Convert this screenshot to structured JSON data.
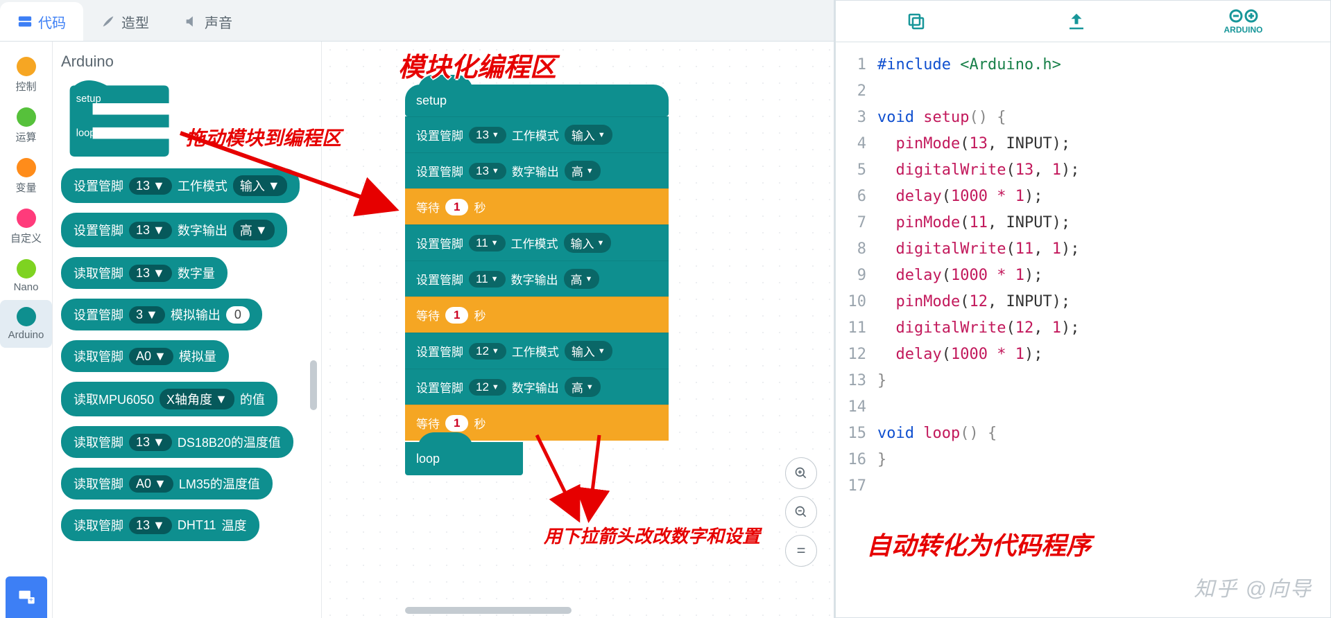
{
  "tabs": {
    "code": "代码",
    "costume": "造型",
    "sound": "声音"
  },
  "categories": [
    {
      "label": "控制",
      "color": "#f6a623"
    },
    {
      "label": "运算",
      "color": "#56c13b"
    },
    {
      "label": "变量",
      "color": "#ff8c1a"
    },
    {
      "label": "自定义",
      "color": "#ff3b7b"
    },
    {
      "label": "Nano",
      "color": "#7ed321"
    },
    {
      "label": "Arduino",
      "color": "#0e8f8f",
      "selected": true
    }
  ],
  "palette": {
    "title": "Arduino",
    "hat": {
      "setup": "setup",
      "loop": "loop"
    },
    "blocks": [
      {
        "parts": [
          "设置管脚",
          {
            "pill": "13 ▾"
          },
          "工作模式",
          {
            "pill": "输入 ▾"
          }
        ]
      },
      {
        "parts": [
          "设置管脚",
          {
            "pill": "13 ▾"
          },
          "数字输出",
          {
            "pill": "高 ▾"
          }
        ]
      },
      {
        "parts": [
          "读取管脚",
          {
            "pill": "13 ▾"
          },
          "数字量"
        ]
      },
      {
        "parts": [
          "设置管脚",
          {
            "pill": "3 ▾"
          },
          "模拟输出",
          {
            "oval": "0"
          }
        ]
      },
      {
        "parts": [
          "读取管脚",
          {
            "pill": "A0 ▾"
          },
          "模拟量"
        ]
      },
      {
        "parts": [
          "读取MPU6050",
          {
            "pill": "X轴角度 ▾"
          },
          "的值"
        ]
      },
      {
        "parts": [
          "读取管脚",
          {
            "pill": "13 ▾"
          },
          "DS18B20的温度值"
        ]
      },
      {
        "parts": [
          "读取管脚",
          {
            "pill": "A0 ▾"
          },
          "LM35的温度值"
        ]
      },
      {
        "parts": [
          "读取管脚",
          {
            "pill": "13"
          },
          "DHT11",
          "温度"
        ]
      }
    ]
  },
  "workspace": {
    "setup": "setup",
    "loop": "loop",
    "rows": [
      {
        "t": "teal",
        "parts": [
          "设置管脚",
          {
            "pill": "13 ▾"
          },
          "工作模式",
          {
            "pill": "输入 ▾"
          }
        ]
      },
      {
        "t": "teal",
        "parts": [
          "设置管脚",
          {
            "pill": "13 ▾"
          },
          "数字输出",
          {
            "pill": "高 ▾"
          }
        ]
      },
      {
        "t": "orange",
        "parts": [
          "等待",
          {
            "oval": "1"
          },
          "秒"
        ]
      },
      {
        "t": "teal",
        "parts": [
          "设置管脚",
          {
            "pill": "11 ▾"
          },
          "工作模式",
          {
            "pill": "输入 ▾"
          }
        ]
      },
      {
        "t": "teal",
        "parts": [
          "设置管脚",
          {
            "pill": "11 ▾"
          },
          "数字输出",
          {
            "pill": "高 ▾"
          }
        ]
      },
      {
        "t": "orange",
        "parts": [
          "等待",
          {
            "oval": "1"
          },
          "秒"
        ]
      },
      {
        "t": "teal",
        "parts": [
          "设置管脚",
          {
            "pill": "12 ▾"
          },
          "工作模式",
          {
            "pill": "输入 ▾"
          }
        ]
      },
      {
        "t": "teal",
        "parts": [
          "设置管脚",
          {
            "pill": "12 ▾"
          },
          "数字输出",
          {
            "pill": "高 ▾"
          }
        ]
      },
      {
        "t": "orange",
        "parts": [
          "等待",
          {
            "oval": "1"
          },
          "秒"
        ]
      }
    ]
  },
  "annotations": {
    "area_title": "模块化编程区",
    "drag_hint": "拖动模块到编程区",
    "dropdown_hint": "用下拉箭头改改数字和设置",
    "code_hint": "自动转化为代码程序"
  },
  "code": {
    "lines": 17,
    "src": [
      [
        {
          "c": "kw",
          "t": "#include "
        },
        {
          "c": "inc",
          "t": "<Arduino.h>"
        }
      ],
      [],
      [
        {
          "c": "kw",
          "t": "void"
        },
        {
          "c": "pn",
          "t": " "
        },
        {
          "c": "fn",
          "t": "setup"
        },
        {
          "c": "gray",
          "t": "() {"
        }
      ],
      [
        {
          "c": "pn",
          "t": "  "
        },
        {
          "c": "fn",
          "t": "pinMode"
        },
        {
          "c": "pn",
          "t": "("
        },
        {
          "c": "num",
          "t": "13"
        },
        {
          "c": "pn",
          "t": ", INPUT);"
        }
      ],
      [
        {
          "c": "pn",
          "t": "  "
        },
        {
          "c": "fn",
          "t": "digitalWrite"
        },
        {
          "c": "pn",
          "t": "("
        },
        {
          "c": "num",
          "t": "13"
        },
        {
          "c": "pn",
          "t": ", "
        },
        {
          "c": "num",
          "t": "1"
        },
        {
          "c": "pn",
          "t": ");"
        }
      ],
      [
        {
          "c": "pn",
          "t": "  "
        },
        {
          "c": "fn",
          "t": "delay"
        },
        {
          "c": "pn",
          "t": "("
        },
        {
          "c": "num",
          "t": "1000"
        },
        {
          "c": "pn",
          "t": " "
        },
        {
          "c": "star",
          "t": "*"
        },
        {
          "c": "pn",
          "t": " "
        },
        {
          "c": "num",
          "t": "1"
        },
        {
          "c": "pn",
          "t": ");"
        }
      ],
      [
        {
          "c": "pn",
          "t": "  "
        },
        {
          "c": "fn",
          "t": "pinMode"
        },
        {
          "c": "pn",
          "t": "("
        },
        {
          "c": "num",
          "t": "11"
        },
        {
          "c": "pn",
          "t": ", INPUT);"
        }
      ],
      [
        {
          "c": "pn",
          "t": "  "
        },
        {
          "c": "fn",
          "t": "digitalWrite"
        },
        {
          "c": "pn",
          "t": "("
        },
        {
          "c": "num",
          "t": "11"
        },
        {
          "c": "pn",
          "t": ", "
        },
        {
          "c": "num",
          "t": "1"
        },
        {
          "c": "pn",
          "t": ");"
        }
      ],
      [
        {
          "c": "pn",
          "t": "  "
        },
        {
          "c": "fn",
          "t": "delay"
        },
        {
          "c": "pn",
          "t": "("
        },
        {
          "c": "num",
          "t": "1000"
        },
        {
          "c": "pn",
          "t": " "
        },
        {
          "c": "star",
          "t": "*"
        },
        {
          "c": "pn",
          "t": " "
        },
        {
          "c": "num",
          "t": "1"
        },
        {
          "c": "pn",
          "t": ");"
        }
      ],
      [
        {
          "c": "pn",
          "t": "  "
        },
        {
          "c": "fn",
          "t": "pinMode"
        },
        {
          "c": "pn",
          "t": "("
        },
        {
          "c": "num",
          "t": "12"
        },
        {
          "c": "pn",
          "t": ", INPUT);"
        }
      ],
      [
        {
          "c": "pn",
          "t": "  "
        },
        {
          "c": "fn",
          "t": "digitalWrite"
        },
        {
          "c": "pn",
          "t": "("
        },
        {
          "c": "num",
          "t": "12"
        },
        {
          "c": "pn",
          "t": ", "
        },
        {
          "c": "num",
          "t": "1"
        },
        {
          "c": "pn",
          "t": ");"
        }
      ],
      [
        {
          "c": "pn",
          "t": "  "
        },
        {
          "c": "fn",
          "t": "delay"
        },
        {
          "c": "pn",
          "t": "("
        },
        {
          "c": "num",
          "t": "1000"
        },
        {
          "c": "pn",
          "t": " "
        },
        {
          "c": "star",
          "t": "*"
        },
        {
          "c": "pn",
          "t": " "
        },
        {
          "c": "num",
          "t": "1"
        },
        {
          "c": "pn",
          "t": ");"
        }
      ],
      [
        {
          "c": "gray",
          "t": "}"
        }
      ],
      [],
      [
        {
          "c": "kw",
          "t": "void"
        },
        {
          "c": "pn",
          "t": " "
        },
        {
          "c": "fn",
          "t": "loop"
        },
        {
          "c": "gray",
          "t": "() {"
        }
      ],
      [
        {
          "c": "gray",
          "t": "}"
        }
      ],
      []
    ]
  },
  "watermark": "知乎 @向导"
}
